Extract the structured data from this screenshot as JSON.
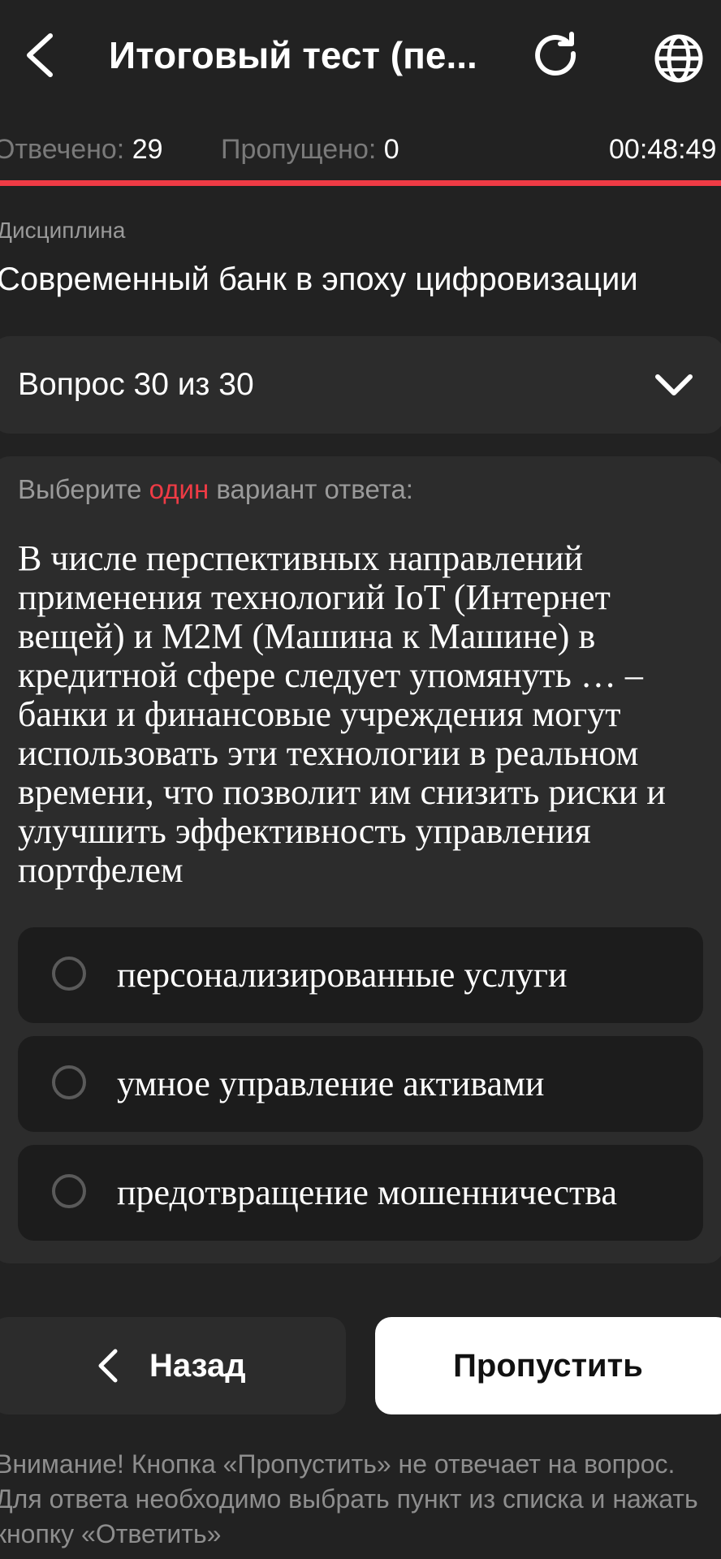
{
  "header": {
    "title": "Итоговый тест (пе...",
    "back_icon": "chevron-left-icon",
    "refresh_icon": "refresh-icon",
    "language_icon": "globe-icon"
  },
  "stats": {
    "answered_label": "Отвечено:",
    "answered_value": "29",
    "skipped_label": "Пропущено:",
    "skipped_value": "0",
    "timer": "00:48:49",
    "progress_fraction": 1.0
  },
  "discipline": {
    "label": "Дисциплина",
    "name": "Современный банк в эпоху цифровизации"
  },
  "question_selector": {
    "label": "Вопрос 30 из 30"
  },
  "question": {
    "instruction_before": "Выберите ",
    "instruction_accent": "один",
    "instruction_after": " вариант ответа:",
    "text": "В числе перспективных направлений применения технологий IoT (Интернет вещей) и M2M (Машина к Машине) в кредитной сфере следует упомянуть … – банки и финансовые учреждения могут использовать эти технологии в реальном времени, что позволит им снизить риски и улучшить эффективность управления портфелем",
    "options": [
      {
        "label": "персонализированные услуги"
      },
      {
        "label": "умное управление активами"
      },
      {
        "label": "предотвращение мошенничества"
      }
    ]
  },
  "buttons": {
    "back_label": "Назад",
    "skip_label": "Пропустить"
  },
  "warning": "Внимание! Кнопка «Пропустить» не отвечает на вопрос. Для ответа необходимо выбрать пункт из списка и нажать кнопку «Ответить»",
  "colors": {
    "background": "#222222",
    "card": "#2c2c2c",
    "accent": "#ef3b45"
  }
}
